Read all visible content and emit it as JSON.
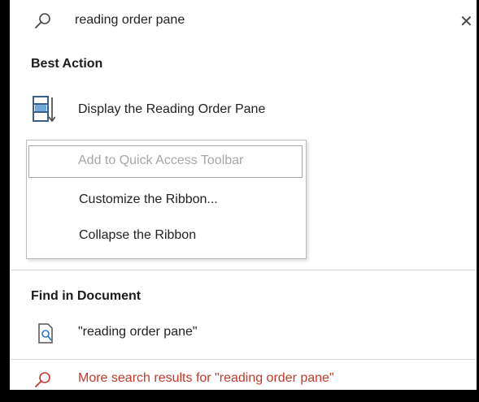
{
  "search": {
    "query": "reading order pane",
    "close_glyph": "✕"
  },
  "best_action": {
    "title": "Best Action",
    "item_label": "Display the Reading Order Pane",
    "icon": "reading-order-pane-icon"
  },
  "context_menu": {
    "items": [
      {
        "label": "Add to Quick Access Toolbar",
        "enabled": false
      },
      {
        "label": "Customize the Ribbon...",
        "enabled": true
      },
      {
        "label": "Collapse the Ribbon",
        "enabled": true
      }
    ]
  },
  "find_in_document": {
    "title": "Find in Document",
    "item_label": "\"reading order pane\"",
    "icon": "find-document-icon"
  },
  "more_results": {
    "label": "More search results for \"reading order pane\"",
    "icon": "search-icon",
    "color": "#c0392b"
  }
}
